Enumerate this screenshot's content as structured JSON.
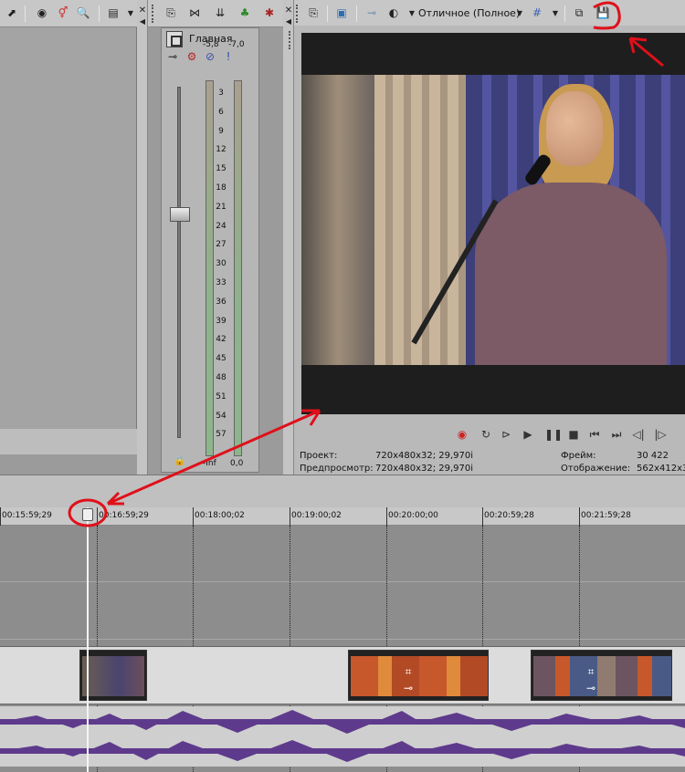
{
  "mixer": {
    "title": "Главная",
    "peak_left": "-5,8",
    "peak_right": "-7,0",
    "foot_left": "-Inf",
    "foot_right": "0,0",
    "scale": [
      "3",
      "6",
      "9",
      "12",
      "15",
      "18",
      "21",
      "24",
      "27",
      "30",
      "33",
      "36",
      "39",
      "42",
      "45",
      "48",
      "51",
      "54",
      "57"
    ]
  },
  "preview": {
    "quality_label": "Отличное (Полное)"
  },
  "info": {
    "project_label": "Проект:",
    "project_value": "720x480x32; 29,970i",
    "preview_label": "Предпросмотр:",
    "preview_value": "720x480x32; 29,970i",
    "frame_label": "Фрейм:",
    "frame_value": "30 422",
    "display_label": "Отображение:",
    "display_value": "562x412x3"
  },
  "ruler": {
    "labels": [
      "00:15:59;29",
      "00:16:59;29",
      "00:18:00;02",
      "00:19:00;02",
      "00:20:00;00",
      "00:20:59;28",
      "00:21:59;28"
    ]
  },
  "colors": {
    "annotation": "#e0101a",
    "waveform": "#5e3a8c",
    "clip_orange": "#c7582b"
  },
  "icons": [
    "pointer-icon",
    "globe-icon",
    "gender-icon",
    "zoom-icon",
    "layout-icon",
    "split-icon",
    "play-icon",
    "save-icon",
    "record-icon",
    "loop-icon",
    "stop-icon",
    "pause-icon"
  ]
}
